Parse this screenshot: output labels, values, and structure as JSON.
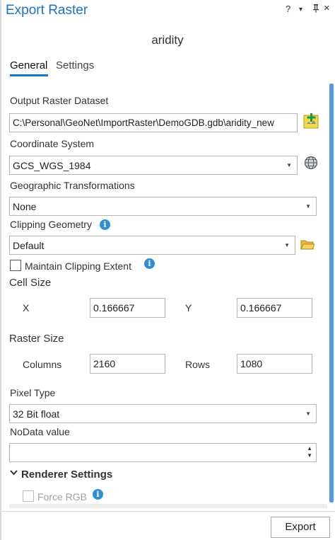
{
  "window": {
    "title": "Export Raster",
    "controls": {
      "help": "?",
      "menu": "▾",
      "pin": "ᵖ",
      "close": "×"
    },
    "dataset_name": "aridity"
  },
  "tabs": [
    {
      "label": "General",
      "active": true
    },
    {
      "label": "Settings",
      "active": false
    }
  ],
  "form": {
    "output_raster": {
      "label": "Output Raster Dataset",
      "value": "C:\\Personal\\GeoNet\\ImportRaster\\DemoGDB.gdb\\aridity_new"
    },
    "coordinate_system": {
      "label": "Coordinate System",
      "value": "GCS_WGS_1984"
    },
    "geo_transform": {
      "label": "Geographic Transformations",
      "value": "None"
    },
    "clipping_geometry": {
      "label": "Clipping Geometry",
      "value": "Default"
    },
    "maintain_clipping": {
      "label": "Maintain Clipping Extent",
      "checked": false
    },
    "cell_size": {
      "heading": "Cell Size",
      "x_label": "X",
      "x_value": "0.166667",
      "y_label": "Y",
      "y_value": "0.166667"
    },
    "raster_size": {
      "heading": "Raster Size",
      "columns_label": "Columns",
      "columns_value": "2160",
      "rows_label": "Rows",
      "rows_value": "1080"
    },
    "pixel_type": {
      "label": "Pixel Type",
      "value": "32 Bit float"
    },
    "nodata": {
      "label": "NoData value",
      "value": ""
    },
    "renderer": {
      "heading": "Renderer Settings",
      "force_rgb_label": "Force RGB",
      "force_rgb_checked": false
    }
  },
  "footer": {
    "export_label": "Export"
  },
  "colors": {
    "accent": "#1a73c8",
    "info": "#2f8fd4",
    "scrollbar": "#5d9ad8",
    "add_icon": "#f2d949"
  },
  "icons": [
    "add-dataset-icon",
    "globe-icon",
    "info-icon",
    "folder-icon",
    "chevron-down-icon"
  ]
}
